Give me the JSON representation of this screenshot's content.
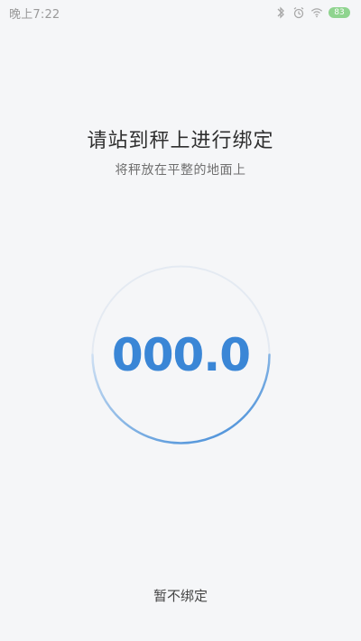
{
  "status_bar": {
    "time": "晚上7:22",
    "icons": [
      "bluetooth-icon",
      "alarm-icon",
      "wifi-icon"
    ],
    "battery": "83"
  },
  "main": {
    "title": "请站到秤上进行绑定",
    "subtitle": "将秤放在平整的地面上"
  },
  "scale": {
    "weight": "000.0",
    "accent_color": "#3a86d6",
    "track_color": "#e4eaf2"
  },
  "footer": {
    "skip_label": "暂不绑定"
  }
}
